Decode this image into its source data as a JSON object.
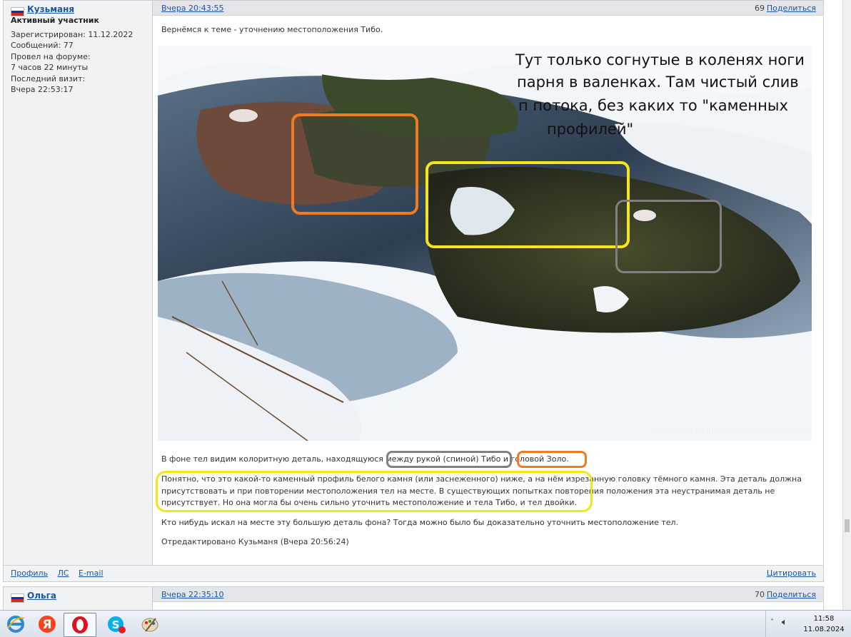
{
  "post1": {
    "author": "Кузьманя",
    "rank": "Активный участник",
    "info": [
      "Зарегистрирован: 11.12.2022",
      "Сообщений: 77",
      "Провел на форуме:",
      "7 часов 22 минуты",
      "Последний визит:",
      "Вчера 22:53:17"
    ],
    "time": "Вчера 20:43:55",
    "number": "69",
    "share": "Поделиться",
    "intro": "Вернёмся к теме - уточнению местоположения Тибо.",
    "photo_caption_lines": [
      "Тут только согнутые в коленях ноги",
      "парня в валенках. Там чистый слив",
      "п  потока, без каких то \"каменных",
      "профилей\""
    ],
    "photo_watermark": "Ольга Литвинова Sledopyt1959",
    "para1": "В фоне тел видим колоритную деталь, находящуюся между рукой (спиной) Тибо и головой Золо.",
    "para2": [
      "Понятно, что это какой-то каменный профиль белого камня (или заснеженного) ниже, а на нём изрезанную головку тёмного камня. Эта деталь должна",
      "присутствовать и при повторении местоположения тел на месте. В существующих попытках повторения положения эта неустранимая деталь не",
      "присутствует. Но она могла бы очень сильно уточнить местоположение и  тела Тибо, и тел двойки."
    ],
    "para3": "Кто нибудь искал на месте эту большую деталь фона? Тогда можно было бы доказательно уточнить местоположение тел.",
    "edited": "Отредактировано Кузьманя (Вчера 20:56:24)",
    "footer_links": [
      "Профиль",
      "ЛС",
      "E-mail"
    ],
    "quote": "Цитировать"
  },
  "post2": {
    "author": "Ольга",
    "time": "Вчера 22:35:10",
    "number": "70",
    "share": "Поделиться"
  },
  "taskbar": {
    "clock_time": "11:58",
    "clock_date": "11.08.2024",
    "icons": [
      "ie-icon",
      "yandex-icon",
      "opera-icon",
      "skype-icon",
      "paint-icon"
    ]
  },
  "colors": {
    "orange_box": "#f07a22",
    "yellow_box": "#f5e61a",
    "gray_box": "#808080",
    "link": "#1a56a8"
  }
}
